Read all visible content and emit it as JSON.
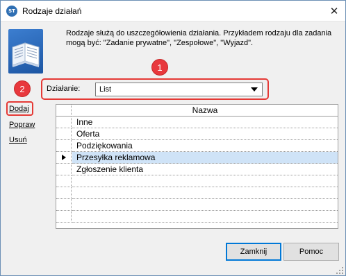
{
  "window": {
    "title": "Rodzaje działań",
    "app_icon_text": "ST",
    "close_glyph": "✕"
  },
  "header": {
    "icon": "open-book-icon",
    "description": "Rodzaje służą do uszczegółowienia działania. Przykładem rodzaju dla zadania mogą być: \"Zadanie prywatne\", \"Zespołowe\", \"Wyjazd\"."
  },
  "annotations": {
    "badge1": "1",
    "badge2": "2"
  },
  "filter": {
    "label": "Działanie:",
    "selected_value": "List"
  },
  "side_actions": {
    "add": "Dodaj",
    "edit": "Popraw",
    "delete": "Usuń"
  },
  "grid": {
    "column_header": "Nazwa",
    "rows": [
      "Inne",
      "Oferta",
      "Podziękowania",
      "Przesyłka reklamowa",
      "Zgłoszenie klienta"
    ],
    "selected_row": "Przesyłka reklamowa"
  },
  "buttons": {
    "close": "Zamknij",
    "help": "Pomoc"
  },
  "colors": {
    "annotation_red": "#e53935",
    "selection_blue": "#cfe3f7",
    "focus_blue": "#0078d7"
  }
}
